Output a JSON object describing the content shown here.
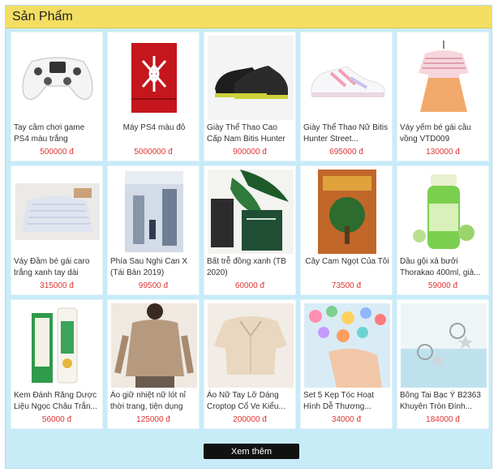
{
  "section_title": "Sản Phẩm",
  "more_button": "Xem thêm",
  "products": [
    {
      "name": "Tay cầm chơi game PS4 màu trắng",
      "price": "500000 đ"
    },
    {
      "name": "Máy PS4 màu đỏ",
      "price": "5000000 đ"
    },
    {
      "name": "Giày Thể Thao Cao Cấp Nam Bitis Hunter X...",
      "price": "900000 đ"
    },
    {
      "name": "Giày Thể Thao Nữ Bitis Hunter Street...",
      "price": "695000 đ"
    },
    {
      "name": "Váy yếm bé gái cầu vồng VTD009",
      "price": "130000 đ"
    },
    {
      "name": "Váy Đầm bé gái caro trắng xanh tay dài",
      "price": "315000 đ"
    },
    {
      "name": "Phía Sau Nghi Can X (Tái Bản 2019)",
      "price": "99500 đ"
    },
    {
      "name": "Bất trễ đồng xanh (TB 2020)",
      "price": "60000 đ"
    },
    {
      "name": "Cây Cam Ngọt Của Tôi",
      "price": "73500 đ"
    },
    {
      "name": "Dầu gội xả bưởi Thorakao 400ml, giả...",
      "price": "59000 đ"
    },
    {
      "name": "Kem Đánh Răng Dược Liệu Ngọc Châu Trắn...",
      "price": "56000 đ"
    },
    {
      "name": "Áo giữ nhiệt nữ lót nỉ thời trang, tiện dụng",
      "price": "125000 đ"
    },
    {
      "name": "Áo Nữ Tay Lỡ Dáng Croptop Cổ Ve Kiểu...",
      "price": "200000 đ"
    },
    {
      "name": "Set 5 Kẹp Tóc Hoạt Hình Dễ Thương...",
      "price": "34000 đ"
    },
    {
      "name": "Bông Tai Bạc Ý B2363 Khuyên Tròn Đính...",
      "price": "184000 đ"
    }
  ]
}
